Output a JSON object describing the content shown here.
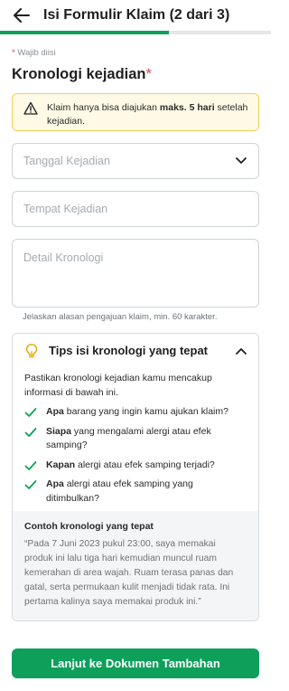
{
  "header": {
    "title": "Isi Formulir Klaim (2 dari 3)"
  },
  "progress": {
    "fraction": 0.6233
  },
  "form": {
    "required_note": "Wajib diisi",
    "required_star": "*",
    "section_title": "Kronologi kejadian",
    "alert": {
      "text_before": "Klaim hanya bisa diajukan ",
      "text_bold": "maks. 5 hari",
      "text_after": " setelah kejadian."
    },
    "date_placeholder": "Tanggal Kejadian",
    "place_placeholder": "Tempat Kejadian",
    "detail_placeholder": "Detail Kronologi",
    "helper": "Jelaskan alasan pengajuan klaim, min. 60 karakter."
  },
  "tips": {
    "title": "Tips isi kronologi yang tepat",
    "intro": "Pastikan kronologi kejadian kamu mencakup informasi di bawah ini.",
    "items": [
      {
        "bold": "Apa",
        "text": " barang yang ingin kamu ajukan klaim?"
      },
      {
        "bold": "Siapa",
        "text": " yang mengalami alergi atau efek samping?"
      },
      {
        "bold": "Kapan",
        "text": " alergi atau efek samping terjadi?"
      },
      {
        "bold": "Apa",
        "text": " alergi atau efek samping yang ditimbulkan?"
      }
    ],
    "example_title": "Contoh kronologi yang tepat",
    "example_text": "“Pada 7 Juni 2023 pukul 23:00, saya memakai produk ini lalu tiga hari kemudian muncul ruam kemerahan di area wajah. Ruam terasa panas dan gatal, serta permukaan kulit menjadi tidak rata. Ini pertama kalinya saya memakai produk ini.”"
  },
  "cta_label": "Lanjut ke Dokumen Tambahan",
  "colors": {
    "accent": "#0ea05a",
    "required": "#e0445a",
    "alert_border": "#f3cf57",
    "alert_bg": "#fffae6"
  },
  "icons": {
    "back": "arrow-left-icon",
    "alert": "warning-icon",
    "date_dropdown": "chevron-down-icon",
    "tips": "lightbulb-icon",
    "collapse": "chevron-up-icon",
    "check": "check-icon"
  }
}
